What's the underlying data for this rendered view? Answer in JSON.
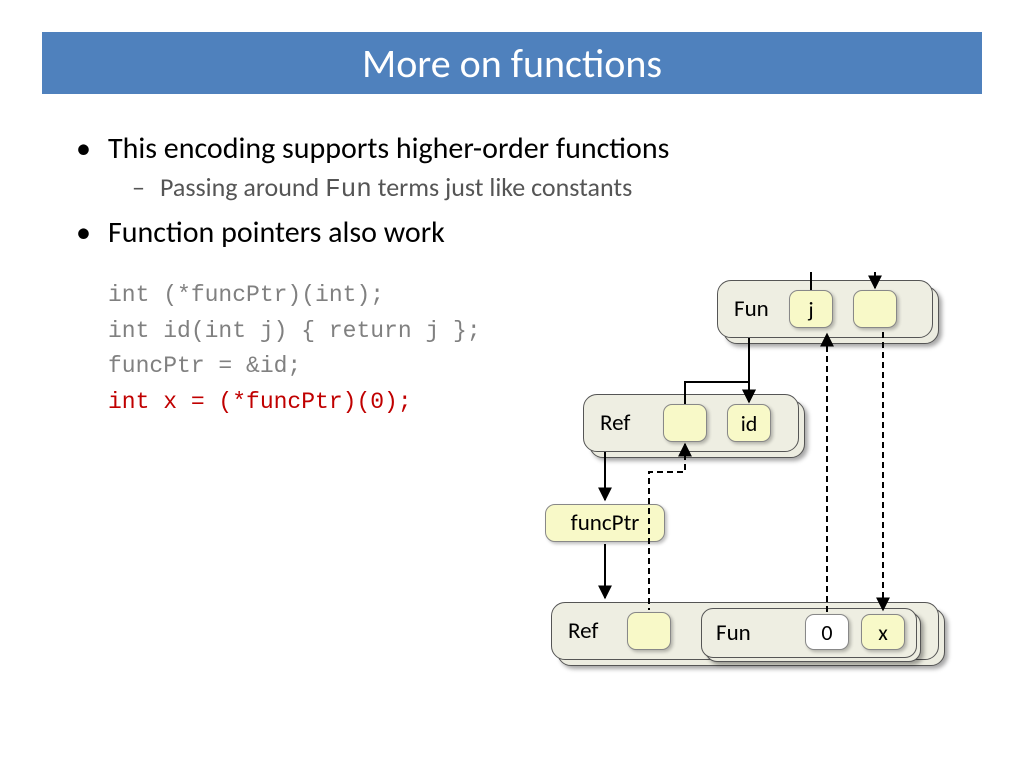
{
  "title": "More on functions",
  "bullets": {
    "b1": "This encoding supports higher-order functions",
    "b1a_pre": "Passing around ",
    "b1a_code": "Fun",
    "b1a_post": " terms just like constants",
    "b2": "Function pointers also work"
  },
  "code": {
    "l1": "int (*funcPtr)(int);",
    "l2": "int id(int j) { return j };",
    "l3": "funcPtr = &id;",
    "l4": "int x = (*funcPtr)(0);"
  },
  "diagram": {
    "fun_top": "Fun",
    "j": "j",
    "ref_mid": "Ref",
    "id": "id",
    "funcptr": "funcPtr",
    "ref_bot": "Ref",
    "fun_bot": "Fun",
    "zero": "0",
    "x": "x"
  }
}
